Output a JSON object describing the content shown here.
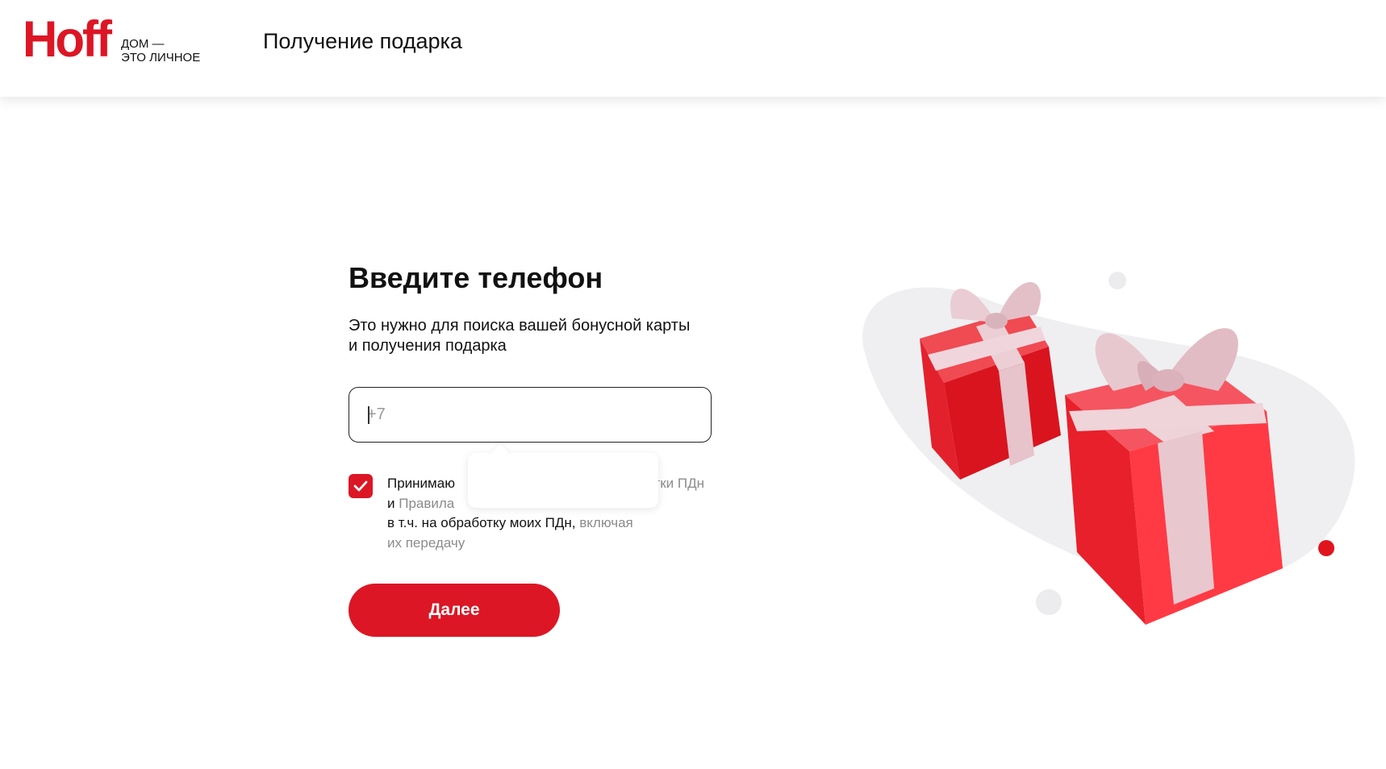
{
  "header": {
    "logo_word": "Hoff",
    "logo_tagline_1": "ДОМ —",
    "logo_tagline_2": "ЭТО ЛИЧНОЕ",
    "title": "Получение подарка"
  },
  "form": {
    "heading": "Введите телефон",
    "description": "Это нужно для поиска вашей бонусной карты и получения подарка",
    "phone_placeholder": "+7",
    "consent": {
      "checked": true,
      "text_1": "Принимаю",
      "link_1": "…тки ПДн",
      "text_2": "и",
      "link_2": "Правила",
      "text_3": "в т.ч. на обработку моих ПДн,",
      "link_3": "включая",
      "link_4": "их передачу"
    },
    "submit_label": "Далее"
  },
  "colors": {
    "accent": "#dc1625",
    "link_gray": "#8b8b8b"
  },
  "icons": {
    "checkbox": "check-icon",
    "illustration": "gift-boxes-illustration"
  }
}
